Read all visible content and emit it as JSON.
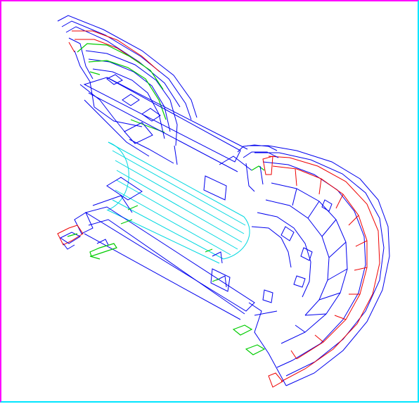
{
  "viewer": {
    "background": "#ffffff",
    "frame_colors": {
      "top_left": "#ff00ff",
      "bottom_right": "#00e5ff"
    },
    "palette": {
      "structure": "#0000ee",
      "calorimeter": "#ee0000",
      "support": "#00cc00",
      "tracker": "#00d8e0"
    }
  }
}
